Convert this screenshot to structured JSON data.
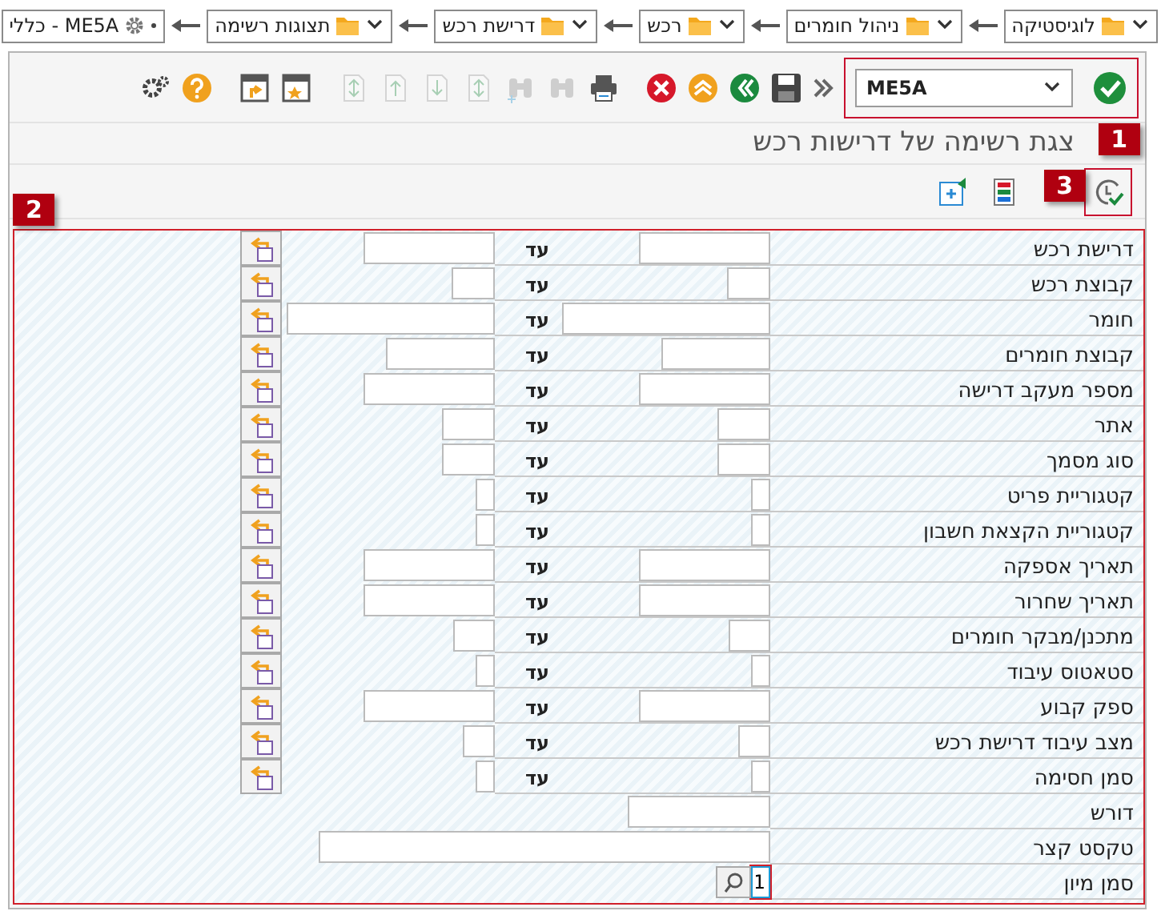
{
  "breadcrumb": [
    {
      "label": "לוגיסטיקה",
      "kind": "folder"
    },
    {
      "label": "ניהול חומרים",
      "kind": "folder"
    },
    {
      "label": "רכש",
      "kind": "folder"
    },
    {
      "label": "דרישת רכש",
      "kind": "folder"
    },
    {
      "label": "תצוגות רשימה",
      "kind": "folder"
    },
    {
      "label": "ME5A - כללי",
      "kind": "transaction"
    }
  ],
  "toolbar": {
    "command": "ME5A",
    "buttons": [
      {
        "kind": "save",
        "disabled": false
      },
      {
        "kind": "back",
        "disabled": false
      },
      {
        "kind": "exit",
        "disabled": false
      },
      {
        "kind": "cancel",
        "disabled": false
      },
      {
        "kind": "print",
        "disabled": false
      },
      {
        "kind": "find",
        "disabled": true
      },
      {
        "kind": "find-next",
        "disabled": true
      },
      {
        "kind": "first-page",
        "disabled": true
      },
      {
        "kind": "prev-page",
        "disabled": true
      },
      {
        "kind": "next-page",
        "disabled": true
      },
      {
        "kind": "last-page",
        "disabled": true
      },
      {
        "kind": "new-session",
        "disabled": false
      },
      {
        "kind": "shortcut",
        "disabled": false
      },
      {
        "kind": "help",
        "disabled": false
      },
      {
        "kind": "settings",
        "disabled": false
      }
    ]
  },
  "title": "צגת רשימה של דרישות רכש",
  "app_toolbar": [
    {
      "kind": "execute"
    },
    {
      "kind": "variants"
    },
    {
      "kind": "dynamic"
    }
  ],
  "callouts": [
    "1",
    "2",
    "3"
  ],
  "fields": [
    {
      "label": "דרישת רכש",
      "kind": "range",
      "to_label": "עד"
    },
    {
      "label": "קבוצת רכש",
      "kind": "range",
      "to_label": "עד"
    },
    {
      "label": "חומר",
      "kind": "range",
      "to_label": "עד"
    },
    {
      "label": "קבוצת חומרים",
      "kind": "range",
      "to_label": "עד"
    },
    {
      "label": "מספר מעקב דרישה",
      "kind": "range",
      "to_label": "עד"
    },
    {
      "label": "אתר",
      "kind": "range",
      "to_label": "עד"
    },
    {
      "label": "סוג מסמך",
      "kind": "range",
      "to_label": "עד"
    },
    {
      "label": "קטגוריית פריט",
      "kind": "range",
      "to_label": "עד"
    },
    {
      "label": "קטגוריית הקצאת חשבון",
      "kind": "range",
      "to_label": "עד"
    },
    {
      "label": "תאריך אספקה",
      "kind": "range",
      "to_label": "עד"
    },
    {
      "label": "תאריך שחרור",
      "kind": "range",
      "to_label": "עד"
    },
    {
      "label": "מתכנן/מבקר חומרים",
      "kind": "range",
      "to_label": "עד"
    },
    {
      "label": "סטאטוס עיבוד",
      "kind": "range",
      "to_label": "עד"
    },
    {
      "label": "ספק קבוע",
      "kind": "range",
      "to_label": "עד"
    },
    {
      "label": "מצב עיבוד דרישת רכש",
      "kind": "range",
      "to_label": "עד"
    },
    {
      "label": "סמן חסימה",
      "kind": "range",
      "to_label": "עד"
    },
    {
      "label": "דורש",
      "kind": "single"
    },
    {
      "label": "טקסט קצר",
      "kind": "single"
    },
    {
      "label": "סמן מיון",
      "kind": "sort",
      "value": "1"
    }
  ]
}
